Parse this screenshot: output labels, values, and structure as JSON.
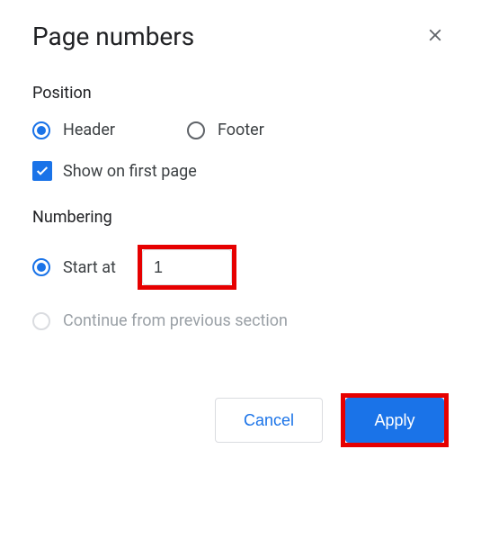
{
  "dialog": {
    "title": "Page numbers"
  },
  "position": {
    "label": "Position",
    "header": "Header",
    "footer": "Footer",
    "show_first": "Show on first page"
  },
  "numbering": {
    "label": "Numbering",
    "start_at": "Start at",
    "start_value": "1",
    "continue": "Continue from previous section"
  },
  "buttons": {
    "cancel": "Cancel",
    "apply": "Apply"
  }
}
